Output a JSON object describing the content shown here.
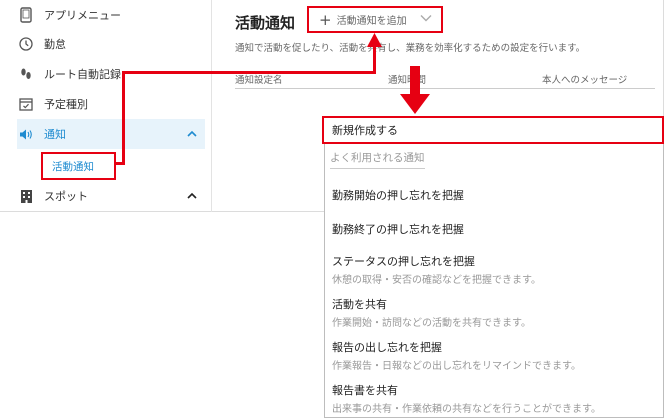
{
  "sidebar": {
    "items": [
      {
        "label": "アプリメニュー"
      },
      {
        "label": "勤怠"
      },
      {
        "label": "ルート自動記録"
      },
      {
        "label": "予定種別"
      },
      {
        "label": "通知",
        "expanded_marker": "^"
      },
      {
        "label": "スポット",
        "expanded_marker": "^"
      }
    ],
    "subitem": {
      "label": "活動通知"
    }
  },
  "main": {
    "title": "活動通知",
    "add_button": {
      "label": "活動通知を追加"
    },
    "description": "通知で活動を促したり、活動を共有し、業務を効率化するための設定を行います。",
    "columns": [
      "通知設定名",
      "通知時間",
      "本人へのメッセージ"
    ]
  },
  "dropdown": {
    "create_new": "新規作成する",
    "section_label": "よく利用される通知",
    "items": [
      {
        "title": "勤務開始の押し忘れを把握",
        "subtitle": ""
      },
      {
        "title": "勤務終了の押し忘れを把握",
        "subtitle": ""
      },
      {
        "title": "ステータスの押し忘れを把握",
        "subtitle": "休憩の取得・安否の確認などを把握できます。"
      },
      {
        "title": "活動を共有",
        "subtitle": "作業開始・訪問などの活動を共有できます。"
      },
      {
        "title": "報告の出し忘れを把握",
        "subtitle": "作業報告・日報などの出し忘れをリマインドできます。"
      },
      {
        "title": "報告書を共有",
        "subtitle": "出来事の共有・作業依頼の共有などを行うことができます。"
      }
    ]
  },
  "colors": {
    "accent": "#1e8bd0",
    "highlight": "#e60012",
    "active_bg": "#e7f3fb"
  }
}
